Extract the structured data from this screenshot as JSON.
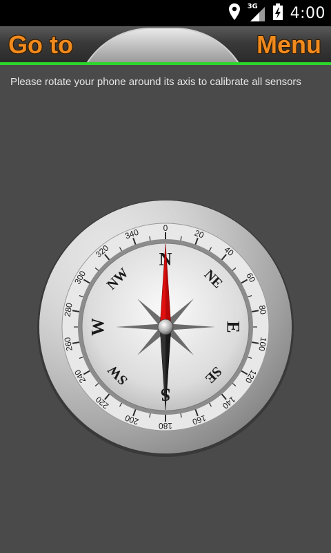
{
  "status_bar": {
    "time": "4:00",
    "network": "3G",
    "icons": [
      "location-pin-icon",
      "signal-icon",
      "battery-icon"
    ]
  },
  "top_bar": {
    "goto_label": "Go to",
    "menu_label": "Menu",
    "accent_color": "#2bd62b",
    "label_color": "#f08a1e"
  },
  "message": "Please rotate your phone around its axis to calibrate all sensors",
  "compass": {
    "heading_degrees": 0,
    "degree_labels": [
      "0",
      "20",
      "40",
      "60",
      "80",
      "100",
      "120",
      "140",
      "160",
      "180",
      "200",
      "220",
      "240",
      "260",
      "280",
      "300",
      "320",
      "340"
    ],
    "cardinals": [
      "N",
      "NE",
      "E",
      "SE",
      "S",
      "SW",
      "W",
      "NW"
    ],
    "needle_north_color": "#e01010",
    "needle_south_color": "#1a1a1a"
  }
}
